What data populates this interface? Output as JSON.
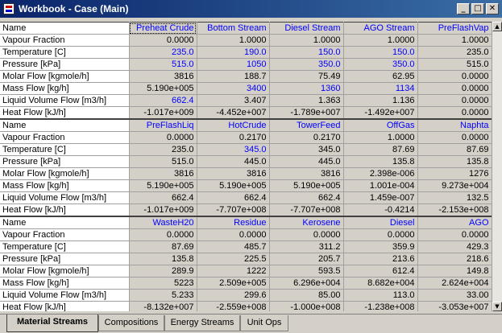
{
  "window": {
    "title": "Workbook - Case (Main)",
    "buttons": {
      "minimize": "_",
      "maximize": "□",
      "close": "✕"
    }
  },
  "grid": {
    "blocks": [
      {
        "header_label": "Name",
        "columns": [
          "Preheat Crude",
          "Bottom Stream",
          "Diesel Stream",
          "AGO Stream",
          "PreFlashVap"
        ],
        "rows": [
          {
            "label": "Vapour Fraction",
            "values": [
              "0.0000",
              "1.0000",
              "1.0000",
              "1.0000",
              "1.0000"
            ],
            "blue": [
              false,
              false,
              false,
              false,
              false
            ]
          },
          {
            "label": "Temperature [C]",
            "values": [
              "235.0",
              "190.0",
              "150.0",
              "150.0",
              "235.0"
            ],
            "blue": [
              true,
              true,
              true,
              true,
              false
            ]
          },
          {
            "label": "Pressure [kPa]",
            "values": [
              "515.0",
              "1050",
              "350.0",
              "350.0",
              "515.0"
            ],
            "blue": [
              true,
              true,
              true,
              true,
              false
            ]
          },
          {
            "label": "Molar Flow [kgmole/h]",
            "values": [
              "3816",
              "188.7",
              "75.49",
              "62.95",
              "0.0000"
            ],
            "blue": [
              false,
              false,
              false,
              false,
              false
            ]
          },
          {
            "label": "Mass Flow [kg/h]",
            "values": [
              "5.190e+005",
              "3400",
              "1360",
              "1134",
              "0.0000"
            ],
            "blue": [
              false,
              true,
              true,
              true,
              false
            ]
          },
          {
            "label": "Liquid Volume Flow [m3/h]",
            "values": [
              "662.4",
              "3.407",
              "1.363",
              "1.136",
              "0.0000"
            ],
            "blue": [
              true,
              false,
              false,
              false,
              false
            ]
          },
          {
            "label": "Heat Flow [kJ/h]",
            "values": [
              "-1.017e+009",
              "-4.452e+007",
              "-1.789e+007",
              "-1.492e+007",
              "0.0000"
            ],
            "blue": [
              false,
              false,
              false,
              false,
              false
            ]
          }
        ]
      },
      {
        "header_label": "Name",
        "columns": [
          "PreFlashLiq",
          "HotCrude",
          "TowerFeed",
          "OffGas",
          "Naphta"
        ],
        "rows": [
          {
            "label": "Vapour Fraction",
            "values": [
              "0.0000",
              "0.2170",
              "0.2170",
              "1.0000",
              "0.0000"
            ],
            "blue": [
              false,
              false,
              false,
              false,
              false
            ]
          },
          {
            "label": "Temperature [C]",
            "values": [
              "235.0",
              "345.0",
              "345.0",
              "87.69",
              "87.69"
            ],
            "blue": [
              false,
              true,
              false,
              false,
              false
            ]
          },
          {
            "label": "Pressure [kPa]",
            "values": [
              "515.0",
              "445.0",
              "445.0",
              "135.8",
              "135.8"
            ],
            "blue": [
              false,
              false,
              false,
              false,
              false
            ]
          },
          {
            "label": "Molar Flow [kgmole/h]",
            "values": [
              "3816",
              "3816",
              "3816",
              "2.398e-006",
              "1276"
            ],
            "blue": [
              false,
              false,
              false,
              false,
              false
            ]
          },
          {
            "label": "Mass Flow [kg/h]",
            "values": [
              "5.190e+005",
              "5.190e+005",
              "5.190e+005",
              "1.001e-004",
              "9.273e+004"
            ],
            "blue": [
              false,
              false,
              false,
              false,
              false
            ]
          },
          {
            "label": "Liquid Volume Flow [m3/h]",
            "values": [
              "662.4",
              "662.4",
              "662.4",
              "1.459e-007",
              "132.5"
            ],
            "blue": [
              false,
              false,
              false,
              false,
              false
            ]
          },
          {
            "label": "Heat Flow [kJ/h]",
            "values": [
              "-1.017e+009",
              "-7.707e+008",
              "-7.707e+008",
              "-0.4214",
              "-2.153e+008"
            ],
            "blue": [
              false,
              false,
              false,
              false,
              false
            ]
          }
        ]
      },
      {
        "header_label": "Name",
        "columns": [
          "WasteH20",
          "Residue",
          "Kerosene",
          "Diesel",
          "AGO"
        ],
        "rows": [
          {
            "label": "Vapour Fraction",
            "values": [
              "0.0000",
              "0.0000",
              "0.0000",
              "0.0000",
              "0.0000"
            ],
            "blue": [
              false,
              false,
              false,
              false,
              false
            ]
          },
          {
            "label": "Temperature [C]",
            "values": [
              "87.69",
              "485.7",
              "311.2",
              "359.9",
              "429.3"
            ],
            "blue": [
              false,
              false,
              false,
              false,
              false
            ]
          },
          {
            "label": "Pressure [kPa]",
            "values": [
              "135.8",
              "225.5",
              "205.7",
              "213.6",
              "218.6"
            ],
            "blue": [
              false,
              false,
              false,
              false,
              false
            ]
          },
          {
            "label": "Molar Flow [kgmole/h]",
            "values": [
              "289.9",
              "1222",
              "593.5",
              "612.4",
              "149.8"
            ],
            "blue": [
              false,
              false,
              false,
              false,
              false
            ]
          },
          {
            "label": "Mass Flow [kg/h]",
            "values": [
              "5223",
              "2.509e+005",
              "6.296e+004",
              "8.682e+004",
              "2.624e+004"
            ],
            "blue": [
              false,
              false,
              false,
              false,
              false
            ]
          },
          {
            "label": "Liquid Volume Flow [m3/h]",
            "values": [
              "5.233",
              "299.6",
              "85.00",
              "113.0",
              "33.00"
            ],
            "blue": [
              false,
              false,
              false,
              false,
              false
            ]
          },
          {
            "label": "Heat Flow [kJ/h]",
            "values": [
              "-8.132e+007",
              "-2.559e+008",
              "-1.000e+008",
              "-1.238e+008",
              "-3.053e+007"
            ],
            "blue": [
              false,
              false,
              false,
              false,
              false
            ]
          }
        ]
      }
    ]
  },
  "scrollbar": {
    "up_glyph": "▲",
    "down_glyph": "▼"
  },
  "tabs": [
    {
      "label": "Material Streams",
      "active": true
    },
    {
      "label": "Compositions",
      "active": false
    },
    {
      "label": "Energy Streams",
      "active": false
    },
    {
      "label": "Unit Ops",
      "active": false
    }
  ],
  "colors": {
    "title_bar": "#0a246a",
    "specified_value": "#0000ff",
    "panel": "#d4d0c8"
  }
}
